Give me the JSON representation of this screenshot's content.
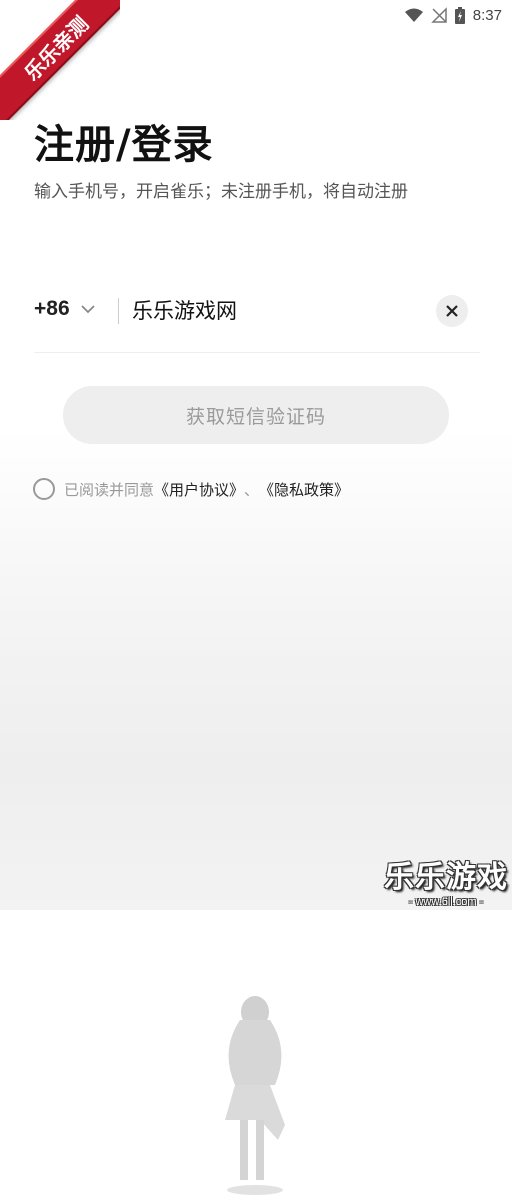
{
  "status_bar": {
    "time": "8:37",
    "icons": [
      "wifi-icon",
      "signal-off-icon",
      "battery-icon"
    ]
  },
  "ribbon": {
    "label": "乐乐亲测",
    "color": "#c0182a"
  },
  "header": {
    "title": "注册/登录",
    "subtitle": "输入手机号，开启雀乐；未注册手机，将自动注册"
  },
  "phone": {
    "country_code": "+86",
    "value": "乐乐游戏网",
    "clear_icon": "close-icon"
  },
  "code_button": {
    "label": "获取短信验证码"
  },
  "agreement": {
    "prefix": "已阅读并同意",
    "user_agreement": "《用户协议》",
    "separator": "、",
    "privacy_policy": "《隐私政策》"
  },
  "watermark": {
    "main": "乐乐游戏",
    "sub": "- www.6ll.com -"
  }
}
